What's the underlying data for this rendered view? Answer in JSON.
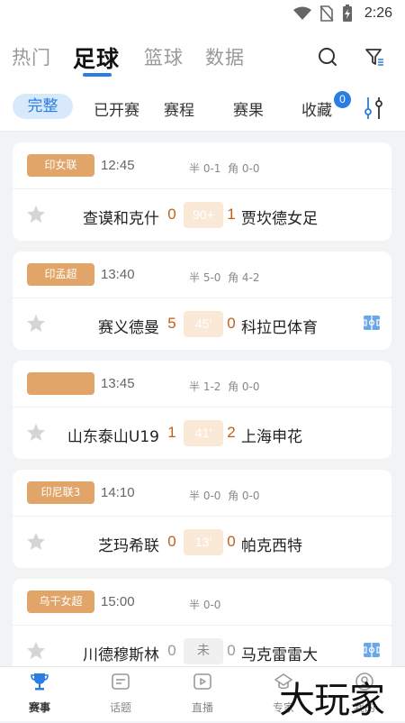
{
  "status_bar": {
    "time": "2:26"
  },
  "top_nav": {
    "tabs": [
      "热门",
      "足球",
      "篮球",
      "数据"
    ],
    "active": "足球"
  },
  "filter_tabs": {
    "items": [
      "完整",
      "已开赛",
      "赛程",
      "赛果",
      "收藏"
    ],
    "active": "完整",
    "favorites_count": "0"
  },
  "matches": [
    {
      "league": "印女联",
      "time": "12:45",
      "half": "半 0-1",
      "corner": "角 0-0",
      "home": "查谟和克什",
      "home_score": "0",
      "minute": "90+",
      "away_score": "1",
      "away": "贾坎德女足",
      "field_icon": false
    },
    {
      "league": "印孟超",
      "time": "13:40",
      "half": "半 5-0",
      "corner": "角 4-2",
      "home": "赛义德曼",
      "home_score": "5",
      "minute": "45'",
      "away_score": "0",
      "away": "科拉巴体育",
      "field_icon": true
    },
    {
      "league": "",
      "time": "13:45",
      "half": "半 1-2",
      "corner": "角 0-0",
      "home": "山东泰山U19",
      "home_score": "1",
      "minute": "41'",
      "away_score": "2",
      "away": "上海申花",
      "field_icon": false
    },
    {
      "league": "印尼联3",
      "time": "14:10",
      "half": "半 0-0",
      "corner": "角 0-0",
      "home": "芝玛希联",
      "home_score": "0",
      "minute": "13'",
      "away_score": "0",
      "away": "帕克西特",
      "field_icon": false
    },
    {
      "league": "乌干女超",
      "time": "15:00",
      "half": "半 0-0",
      "corner": "",
      "home": "川德穆斯林",
      "home_score": "0",
      "minute": "未",
      "away_score": "0",
      "away": "马克雷雷大",
      "field_icon": true
    }
  ],
  "bottom_nav": {
    "items": [
      "赛事",
      "话题",
      "直播",
      "专家",
      "我的"
    ],
    "active": "赛事"
  },
  "watermark": "大玩家",
  "colors": {
    "accent": "#2a7de1",
    "league_tag": "#e2a569",
    "score": "#c0601a"
  }
}
